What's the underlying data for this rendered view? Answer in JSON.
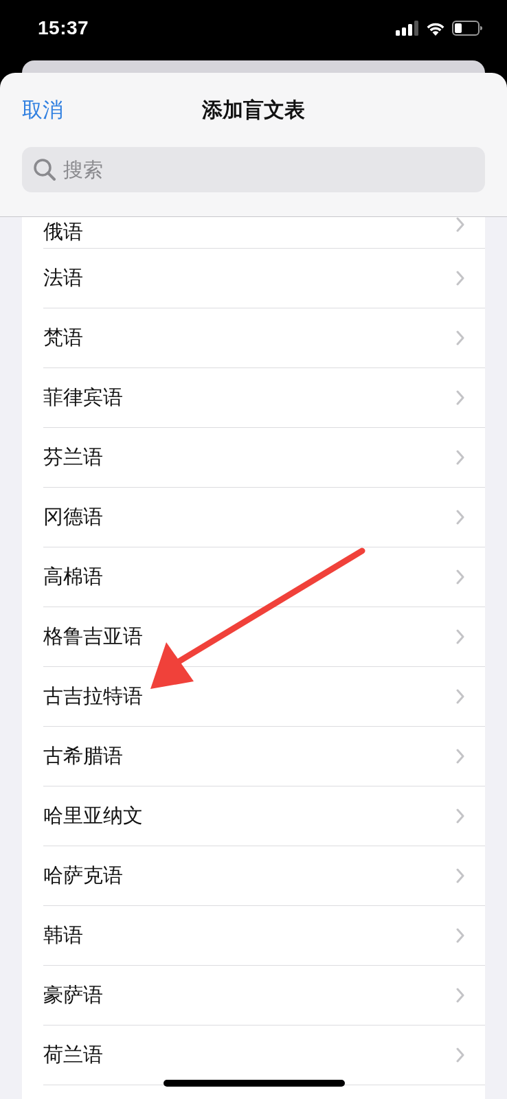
{
  "status_bar": {
    "time": "15:37"
  },
  "sheet": {
    "cancel": "取消",
    "title": "添加盲文表"
  },
  "search": {
    "placeholder": "搜索"
  },
  "languages": [
    {
      "label": "俄语"
    },
    {
      "label": "法语"
    },
    {
      "label": "梵语"
    },
    {
      "label": "菲律宾语"
    },
    {
      "label": "芬兰语"
    },
    {
      "label": "冈德语"
    },
    {
      "label": "高棉语"
    },
    {
      "label": "格鲁吉亚语"
    },
    {
      "label": "古吉拉特语"
    },
    {
      "label": "古希腊语"
    },
    {
      "label": "哈里亚纳文"
    },
    {
      "label": "哈萨克语"
    },
    {
      "label": "韩语"
    },
    {
      "label": "豪萨语"
    },
    {
      "label": "荷兰语"
    }
  ]
}
